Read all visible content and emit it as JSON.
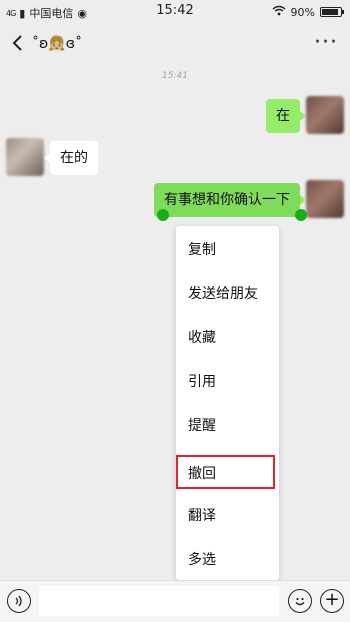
{
  "status_bar": {
    "signal": "4G",
    "carrier": "中国电信",
    "time": "15:42",
    "battery": "90%",
    "battery_level": 0.9
  },
  "header": {
    "title": "˚ʚ👧🏼ɞ˚",
    "back_icon": "chevron-left-icon",
    "more_icon": "more-dots-icon",
    "more_glyph": "···"
  },
  "chat": {
    "timestamp": "15:41",
    "messages": [
      {
        "sender": "me",
        "text": "在"
      },
      {
        "sender": "other",
        "text": "在的"
      },
      {
        "sender": "me",
        "text": "有事想和你确认一下",
        "selected": true
      }
    ]
  },
  "context_menu": {
    "items": [
      {
        "label": "复制"
      },
      {
        "label": "发送给朋友"
      },
      {
        "label": "收藏"
      },
      {
        "label": "引用"
      },
      {
        "label": "提醒"
      },
      {
        "label": "撤回",
        "highlighted": true
      },
      {
        "label": "翻译"
      },
      {
        "label": "多选"
      }
    ],
    "highlight_color": "#e0262c"
  },
  "input_bar": {
    "voice_icon": "voice-icon",
    "emoji_icon": "emoji-icon",
    "plus_icon": "plus-icon",
    "plus_glyph": "+",
    "input_value": ""
  },
  "colors": {
    "my_bubble": "#95ec69",
    "other_bubble": "#ffffff",
    "background": "#ededed",
    "selection_handle": "#1aad19"
  }
}
